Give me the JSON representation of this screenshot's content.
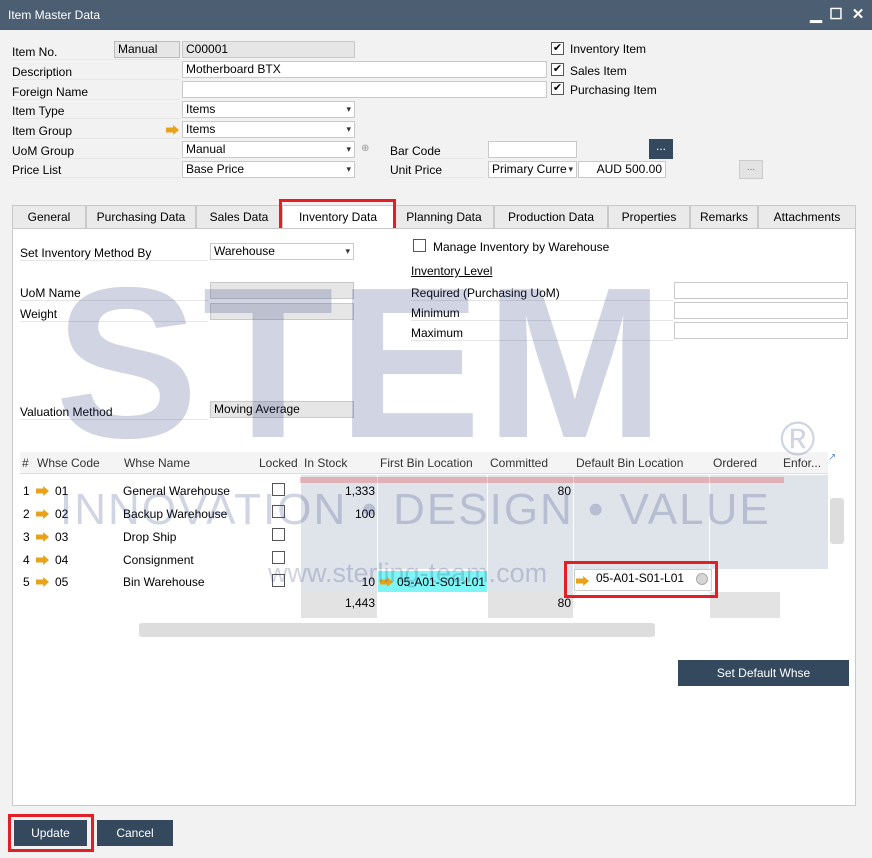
{
  "window": {
    "title": "Item Master Data",
    "minimize": "▁",
    "maximize": "☐",
    "close": "✕"
  },
  "header": {
    "item_no_label": "Item No.",
    "item_no_series": "Manual",
    "item_no_value": "C00001",
    "description_label": "Description",
    "description_value": "Motherboard BTX",
    "foreign_name_label": "Foreign Name",
    "foreign_name_value": "",
    "item_type_label": "Item Type",
    "item_type_value": "Items",
    "item_group_label": "Item Group",
    "item_group_value": "Items",
    "uom_group_label": "UoM Group",
    "uom_group_value": "Manual",
    "price_list_label": "Price List",
    "price_list_value": "Base Price",
    "bar_code_label": "Bar Code",
    "bar_code_value": "",
    "unit_price_label": "Unit Price",
    "unit_price_currency": "Primary Curre",
    "unit_price_value": "AUD 500.00",
    "ellipsis": "...",
    "inventory_item_label": "Inventory Item",
    "sales_item_label": "Sales Item",
    "purchasing_item_label": "Purchasing Item"
  },
  "tabs": [
    "General",
    "Purchasing Data",
    "Sales Data",
    "Inventory Data",
    "Planning Data",
    "Production Data",
    "Properties",
    "Remarks",
    "Attachments"
  ],
  "inventory": {
    "set_method_label": "Set Inventory Method By",
    "set_method_value": "Warehouse",
    "manage_by_whse_label": "Manage Inventory by Warehouse",
    "inventory_level_label": "Inventory Level",
    "required_label": "Required (Purchasing UoM)",
    "minimum_label": "Minimum",
    "maximum_label": "Maximum",
    "uom_name_label": "UoM Name",
    "weight_label": "Weight",
    "valuation_label": "Valuation Method",
    "valuation_value": "Moving Average"
  },
  "grid": {
    "columns": [
      "#",
      "Whse Code",
      "Whse Name",
      "Locked",
      "In Stock",
      "First Bin Location",
      "Committed",
      "Default Bin Location",
      "Ordered",
      "Enfor..."
    ],
    "rows": [
      {
        "num": "1",
        "code": "01",
        "name": "General Warehouse",
        "in_stock": "1,333",
        "first_bin": "",
        "committed": "80",
        "default_bin": ""
      },
      {
        "num": "2",
        "code": "02",
        "name": "Backup Warehouse",
        "in_stock": "100",
        "first_bin": "",
        "committed": "",
        "default_bin": ""
      },
      {
        "num": "3",
        "code": "03",
        "name": "Drop Ship",
        "in_stock": "",
        "first_bin": "",
        "committed": "",
        "default_bin": ""
      },
      {
        "num": "4",
        "code": "04",
        "name": "Consignment",
        "in_stock": "",
        "first_bin": "",
        "committed": "",
        "default_bin": ""
      },
      {
        "num": "5",
        "code": "05",
        "name": "Bin Warehouse",
        "in_stock": "10",
        "first_bin": "05-A01-S01-L01",
        "committed": "",
        "default_bin": "05-A01-S01-L01"
      }
    ],
    "total_in_stock": "1,443",
    "total_committed": "80"
  },
  "buttons": {
    "set_default_whse": "Set Default Whse",
    "update": "Update",
    "cancel": "Cancel"
  },
  "watermark": {
    "logo": "STEM",
    "registered": "®",
    "tagline": "INNOVATION • DESIGN • VALUE",
    "url": "www.sterling-team.com"
  },
  "colors": {
    "titlebar": "#4c5e72",
    "button": "#34495e",
    "highlight_red": "#e31e24",
    "bin_cyan": "#7ff6f6",
    "arrow_orange": "#e8a31a"
  }
}
